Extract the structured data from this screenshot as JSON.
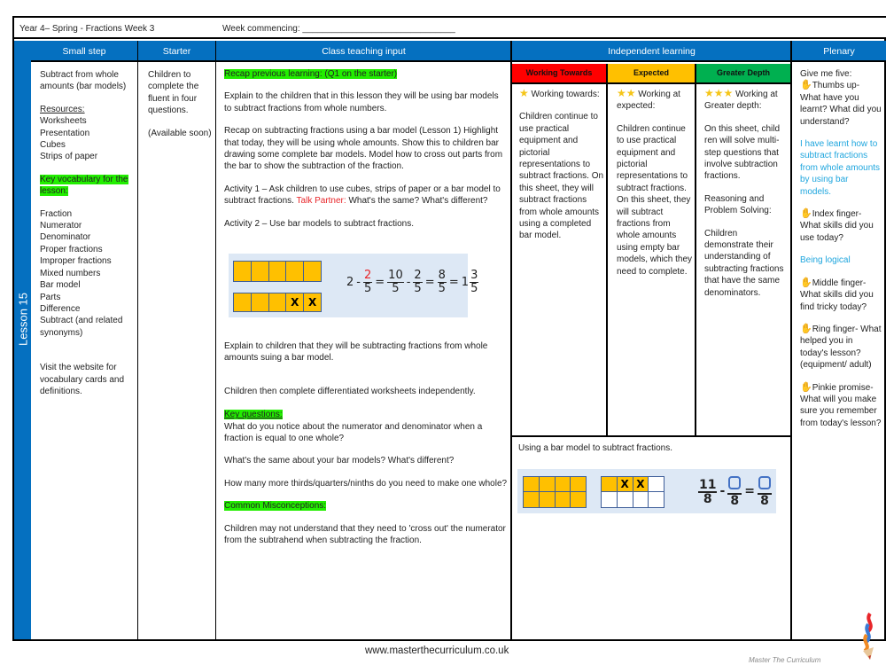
{
  "header": {
    "title": "Year 4– Spring - Fractions Week 3",
    "week_commencing": "Week commencing: _______________________________"
  },
  "lesson_label": "Lesson 15",
  "columns": {
    "small_step": "Small step",
    "starter": "Starter",
    "class_teaching": "Class teaching input",
    "independent": "Independent learning",
    "plenary": "Plenary"
  },
  "small_step": {
    "title": "Subtract from whole amounts (bar models)",
    "resources_heading": "Resources:",
    "resources": [
      "Worksheets",
      "Presentation",
      "Cubes",
      "Strips of paper"
    ],
    "vocab_heading": "Key vocabulary for the lesson:",
    "vocab": [
      "Fraction",
      "Numerator",
      "Denominator",
      "Proper fractions",
      "Improper fractions",
      "Mixed numbers",
      "Bar model",
      "Parts",
      "Difference",
      "Subtract (and related synonyms)"
    ],
    "website_note": "Visit the website for vocabulary cards and definitions."
  },
  "starter": {
    "text": "Children to complete the fluent in four questions.",
    "note": "(Available soon)"
  },
  "teaching": {
    "recap": "Recap previous learning: (Q1 on the starter)",
    "p1": "Explain to the children that in this lesson they will be using bar models to subtract fractions from whole numbers.",
    "p2": "Recap on subtracting fractions using a bar model (Lesson 1) Highlight that today, they will be using whole amounts. Show this to children bar drawing some complete bar models. Model how to cross out parts from the bar to show the subtraction of the fraction.",
    "activity1_a": "Activity 1 – Ask children to use cubes, strips of paper or a bar model to subtract fractions. ",
    "talk_partner": "Talk Partner:",
    "activity1_b": " What's the same? What's different?",
    "activity2": "Activity 2 – Use bar models to subtract fractions.",
    "model": {
      "bar1": [
        "",
        "",
        "",
        "",
        ""
      ],
      "bar2": [
        "",
        "",
        "",
        "X",
        "X"
      ],
      "equation": {
        "whole": "2",
        "minus": "-",
        "f1": {
          "num": "2",
          "den": "5"
        },
        "eq1": "=",
        "f2": {
          "num": "10",
          "den": "5"
        },
        "minus2": "-",
        "f3": {
          "num": "2",
          "den": "5"
        },
        "eq2": "=",
        "f4": {
          "num": "8",
          "den": "5"
        },
        "eq3": "=",
        "mixed_whole": "1",
        "f5": {
          "num": "3",
          "den": "5"
        }
      }
    },
    "p3": "Explain to children that they will be subtracting fractions from whole amounts suing a bar model.",
    "p4": "Children then complete differentiated worksheets independently.",
    "key_questions_heading": "Key questions:",
    "kq1": "What do you notice about the numerator and denominator when a fraction is equal to one whole?",
    "kq2": "What's the same about your bar models?  What's different?",
    "kq3": "How many more thirds/quarters/ninths do you need to make one whole?",
    "misconceptions_heading": "Common Misconceptions:",
    "misconception": "Children may not understand that they need to 'cross out' the numerator from the subtrahend when subtracting the fraction."
  },
  "independent": {
    "levels": [
      {
        "label": "Working Towards",
        "color": "#ff0000",
        "stars": "★",
        "heading": "Working towards:",
        "text": "Children continue to use practical equipment and pictorial representations to subtract fractions. On this sheet, they will subtract fractions from whole amounts using a completed bar model."
      },
      {
        "label": "Expected",
        "color": "#ffc000",
        "stars": "★★",
        "heading": "Working at expected:",
        "text": "Children continue to use practical equipment and pictorial representations to subtract fractions. On this sheet, they will subtract fractions from whole amounts using empty bar models, which they need to complete."
      },
      {
        "label": "Greater Depth",
        "color": "#00b050",
        "stars": "★★★",
        "heading": "Working at Greater depth:",
        "text": "On this sheet, child ren will solve multi-step questions that involve subtraction fractions.",
        "text2": "Reasoning and Problem Solving:",
        "text3": "Children demonstrate their understanding of subtracting fractions that have the same denominators."
      }
    ],
    "example_caption": "Using a bar model to subtract fractions.",
    "example": {
      "grid1_top": [
        "",
        "",
        "",
        ""
      ],
      "grid1_bottom": [
        "",
        "",
        "",
        ""
      ],
      "grid2_top": [
        "",
        "X",
        "X",
        ""
      ],
      "grid2_bottom": [
        "",
        "",
        "",
        ""
      ],
      "f1": {
        "num": "11",
        "den": "8"
      },
      "minus": "-",
      "f2_den": "8",
      "eq": "=",
      "f3_den": "8"
    }
  },
  "plenary": {
    "intro": "Give me five:",
    "thumb": "Thumbs up- What have you learnt? What did you understand?",
    "thumb_answer": "I have learnt how to subtract fractions from whole amounts by using bar models.",
    "index": "Index finger- What skills did you use today?",
    "index_answer": "Being logical",
    "middle": "Middle finger- What skills did you find tricky today?",
    "ring": "Ring finger- What helped you in today's lesson? (equipment/ adult)",
    "pinkie": "Pinkie promise- What will you make sure you remember from today's lesson?"
  },
  "footer": {
    "url": "www.masterthecurriculum.co.uk",
    "logo_text": "Master The Curriculum"
  }
}
